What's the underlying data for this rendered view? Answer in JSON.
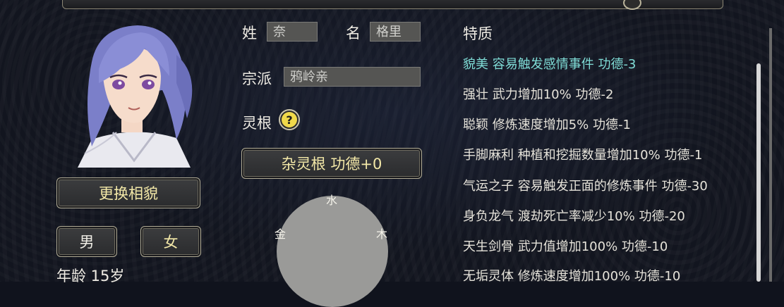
{
  "surname_label": "姓",
  "surname_value": "奈",
  "givenname_label": "名",
  "givenname_value": "格里",
  "sect_label": "宗派",
  "sect_value": "鸦岭亲",
  "root_label": "灵根",
  "help_glyph": "?",
  "root_button": "杂灵根 功德+0",
  "elements": {
    "water": "水",
    "metal": "金",
    "wood": "木"
  },
  "change_look_button": "更换相貌",
  "male_button": "男",
  "female_button": "女",
  "age_text": "年龄 15岁",
  "traits_title": "特质",
  "traits": [
    "貌美 容易触发感情事件 功德-3",
    "强壮 武力增加10% 功德-2",
    "聪颖 修炼速度增加5% 功德-1",
    "手脚麻利 种植和挖掘数量增加10% 功德-1",
    "气运之子 容易触发正面的修炼事件 功德-30",
    "身负龙气 渡劫死亡率减少10% 功德-20",
    "天生剑骨 武力值增加100% 功德-10",
    "无垢灵体 修炼速度增加100% 功德-10"
  ],
  "colors": {
    "highlight": "#7fdcd6",
    "button_text": "#f4e9a8",
    "background": "#12151f"
  }
}
